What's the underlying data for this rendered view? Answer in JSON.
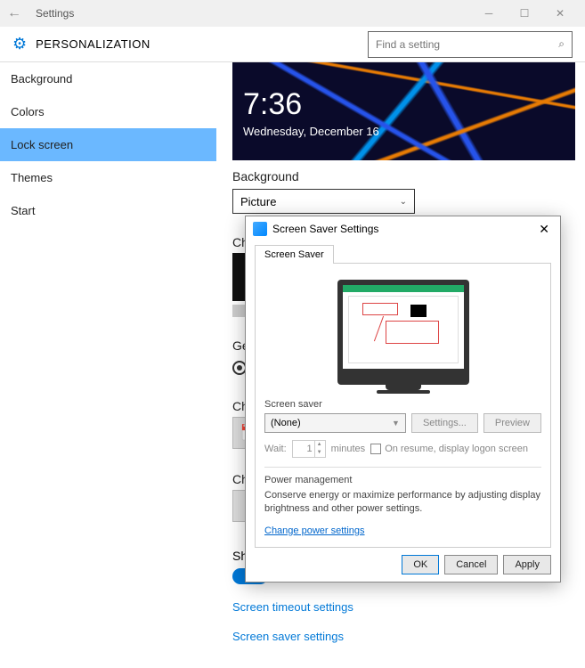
{
  "window": {
    "title": "Settings",
    "header": "PERSONALIZATION",
    "search_placeholder": "Find a setting"
  },
  "sidebar": {
    "items": [
      {
        "label": "Background"
      },
      {
        "label": "Colors"
      },
      {
        "label": "Lock screen"
      },
      {
        "label": "Themes"
      },
      {
        "label": "Start"
      }
    ]
  },
  "lockscreen": {
    "time": "7:36",
    "date": "Wednesday, December 16",
    "bg_label": "Background",
    "bg_value": "Picture",
    "choose_label": "Ch",
    "get_label": "Ge",
    "choose2_label": "Ch",
    "choose3_label": "Ch",
    "show_label": "Sh",
    "toggle_state": "On",
    "link1": "Screen timeout settings",
    "link2": "Screen saver settings"
  },
  "dialog": {
    "title": "Screen Saver Settings",
    "tab": "Screen Saver",
    "ss_label": "Screen saver",
    "ss_value": "(None)",
    "settings_btn": "Settings...",
    "preview_btn": "Preview",
    "wait_label": "Wait:",
    "wait_value": "1",
    "minutes": "minutes",
    "resume_label": "On resume, display logon screen",
    "pm_label": "Power management",
    "pm_text": "Conserve energy or maximize performance by adjusting display brightness and other power settings.",
    "pm_link": "Change power settings",
    "ok": "OK",
    "cancel": "Cancel",
    "apply": "Apply"
  }
}
